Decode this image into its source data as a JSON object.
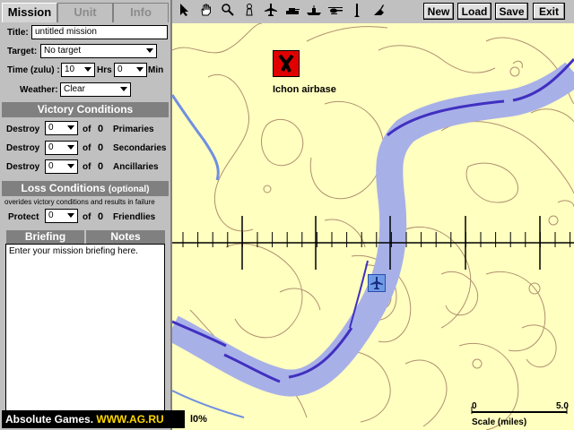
{
  "tabs": [
    "Mission",
    "Unit",
    "Info"
  ],
  "mission": {
    "title_label": "Title:",
    "title_value": "untitled mission",
    "target_label": "Target:",
    "target_value": "No target",
    "time_label": "Time (zulu) :",
    "hours_value": "10",
    "hrs_label": "Hrs",
    "minutes_value": "0",
    "min_label": "Min",
    "weather_label": "Weather:",
    "weather_value": "Clear"
  },
  "victory": {
    "heading": "Victory Conditions",
    "rows": [
      {
        "prefix": "Destroy",
        "value": "0",
        "of": "of",
        "count": "0",
        "kind": "Primaries"
      },
      {
        "prefix": "Destroy",
        "value": "0",
        "of": "of",
        "count": "0",
        "kind": "Secondaries"
      },
      {
        "prefix": "Destroy",
        "value": "0",
        "of": "of",
        "count": "0",
        "kind": "Ancillaries"
      }
    ]
  },
  "loss": {
    "heading": "Loss Conditions",
    "optional": "(optional)",
    "note": "overides victory conditions and results in failure",
    "prefix": "Protect",
    "value": "0",
    "of": "of",
    "count": "0",
    "kind": "Friendlies"
  },
  "briefing_tabs": [
    "Briefing",
    "Notes"
  ],
  "briefing_text": "Enter your mission briefing here.",
  "toolbar": {
    "tools": [
      "arrow-pointer-icon",
      "hand-icon",
      "magnifier-icon",
      "pawn-icon",
      "aircraft-icon",
      "tank-icon",
      "ship-icon",
      "helicopter-icon",
      "missile-icon",
      "eraser-icon"
    ],
    "new_label": "New",
    "load_label": "Load",
    "save_label": "Save",
    "exit_label": "Exit"
  },
  "map": {
    "airbase_label": "Ichon airbase",
    "zoom_text": "l0%",
    "scale_start": "0",
    "scale_end": "5.0",
    "scale_label": "Scale (miles)"
  },
  "colors": {
    "panel": "#c0c0c0",
    "map_land": "#ffffc0",
    "river": "#a8b0e8",
    "river_edge": "#4030c0",
    "contour": "#b09070",
    "airbase": "#e00000"
  },
  "watermark": {
    "brand": "Absolute Games.",
    "url": "WWW.AG.RU"
  }
}
